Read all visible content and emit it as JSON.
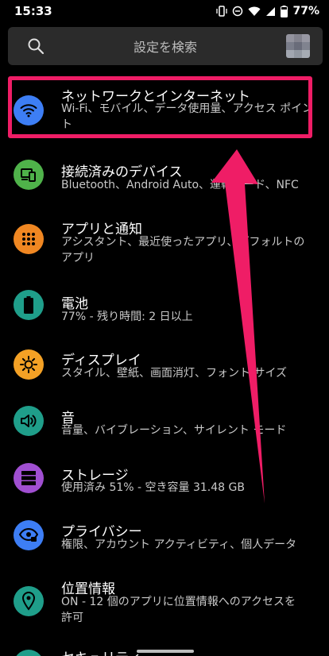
{
  "status": {
    "time": "15:33",
    "battery": "77%"
  },
  "search": {
    "placeholder": "設定を検索"
  },
  "settings": [
    {
      "title": "ネットワークとインターネット",
      "subtitle": "Wi-Fi、モバイル、データ使用量、アクセス ポイント",
      "icon": "wifi-icon",
      "color": "#3d7ef5"
    },
    {
      "title": "接続済みのデバイス",
      "subtitle": "Bluetooth、Android Auto、運転モード、NFC",
      "icon": "devices-icon",
      "color": "#4fb24a"
    },
    {
      "title": "アプリと通知",
      "subtitle": "アシスタント、最近使ったアプリ、デフォルトのアプリ",
      "icon": "apps-grid-icon",
      "color": "#f08722"
    },
    {
      "title": "電池",
      "subtitle": "77% - 残り時間: 2 日以上",
      "icon": "battery-icon",
      "color": "#1f9e8a"
    },
    {
      "title": "ディスプレイ",
      "subtitle": "スタイル、壁紙、画面消灯、フォント サイズ",
      "icon": "brightness-icon",
      "color": "#f4a125"
    },
    {
      "title": "音",
      "subtitle": "音量、バイブレーション、サイレント モード",
      "icon": "sound-icon",
      "color": "#1f9e8a"
    },
    {
      "title": "ストレージ",
      "subtitle": "使用済み 51% - 空き容量 31.48 GB",
      "icon": "storage-icon",
      "color": "#a04fd1"
    },
    {
      "title": "プライバシー",
      "subtitle": "権限、アカウント アクティビティ、個人データ",
      "icon": "privacy-eye-icon",
      "color": "#3d7ef5"
    },
    {
      "title": "位置情報",
      "subtitle": "ON - 12 個のアプリに位置情報へのアクセスを許可",
      "icon": "location-pin-icon",
      "color": "#1f9e8a"
    },
    {
      "title": "セキュリティ",
      "subtitle": "",
      "icon": "security-icon",
      "color": "#1f9e8a"
    }
  ],
  "annotation": {
    "color": "#ef1d66"
  }
}
